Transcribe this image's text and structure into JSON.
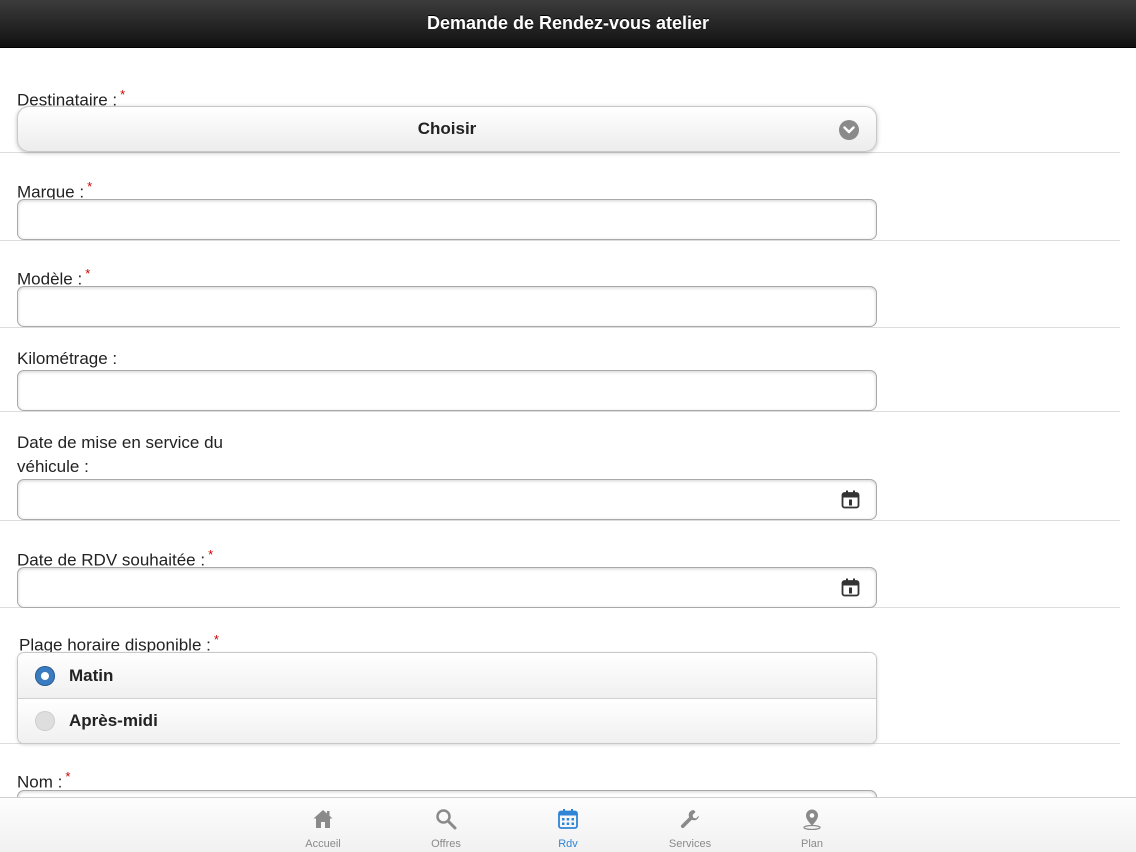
{
  "header": {
    "title": "Demande de Rendez-vous atelier"
  },
  "form": {
    "required_mark": "*",
    "destinataire": {
      "label": "Destinataire :",
      "selected": "Choisir"
    },
    "marque": {
      "label": "Marque :",
      "value": ""
    },
    "modele": {
      "label": "Modèle :",
      "value": ""
    },
    "kilometrage": {
      "label": "Kilométrage :",
      "value": ""
    },
    "date_mise_service": {
      "label_line1": "Date de mise en service du",
      "label_line2": "véhicule :",
      "value": ""
    },
    "date_rdv": {
      "label": "Date de RDV souhaitée :",
      "value": ""
    },
    "plage_horaire": {
      "label": "Plage horaire disponible :",
      "options": [
        {
          "label": "Matin",
          "selected": true
        },
        {
          "label": "Après-midi",
          "selected": false
        }
      ]
    },
    "nom": {
      "label": "Nom :"
    }
  },
  "tabbar": {
    "active_color": "#2f84d6",
    "inactive_color": "#8a8a8a",
    "tabs": [
      {
        "label": "Accueil",
        "icon": "home-icon",
        "active": false
      },
      {
        "label": "Offres",
        "icon": "search-icon",
        "active": false
      },
      {
        "label": "Rdv",
        "icon": "calendar-icon",
        "active": true
      },
      {
        "label": "Services",
        "icon": "wrench-icon",
        "active": false
      },
      {
        "label": "Plan",
        "icon": "map-pin-icon",
        "active": false
      }
    ]
  }
}
